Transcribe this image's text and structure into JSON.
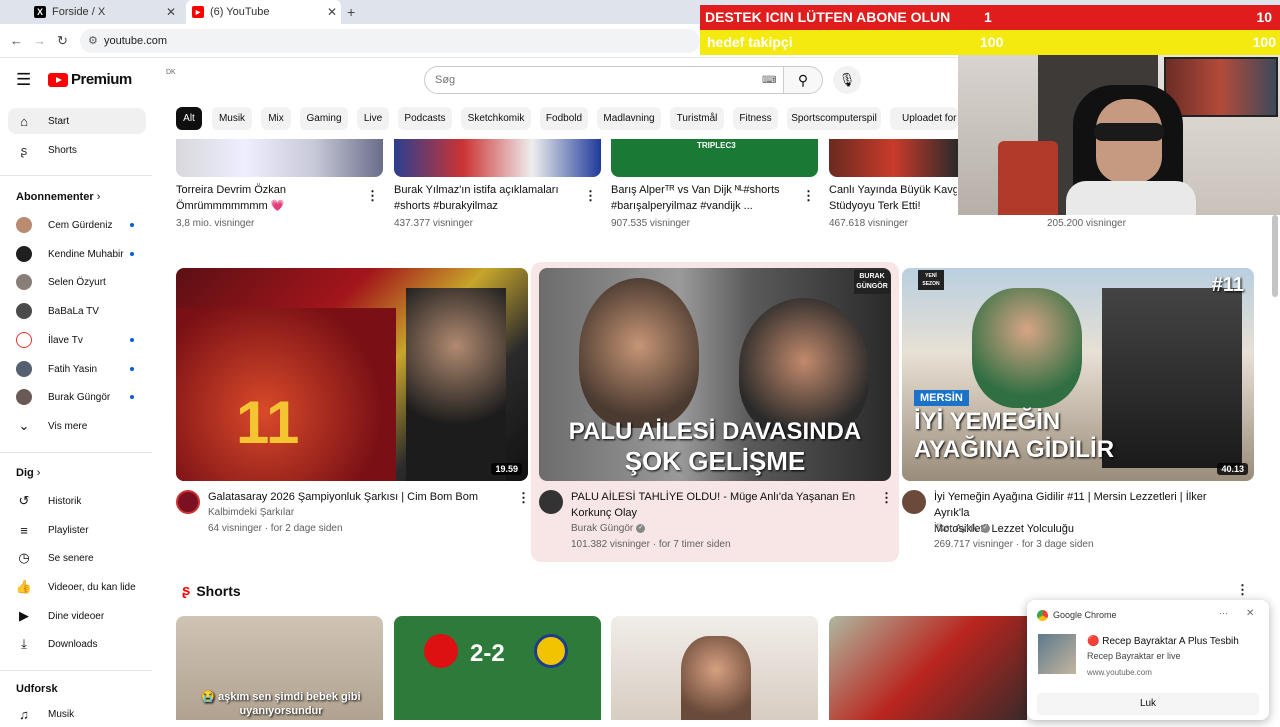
{
  "browser": {
    "tabs": [
      {
        "label": "Forside / X",
        "icon": "x-logo-icon"
      },
      {
        "label": "(6) YouTube",
        "icon": "youtube-icon"
      }
    ],
    "url": "youtube.com"
  },
  "overlay": {
    "line1": {
      "text": "DESTEK ICIN LÜTFEN ABONE OLUN",
      "current": "1",
      "target": "10"
    },
    "line2": {
      "text": "hedef takipçi",
      "current": "100",
      "target": "100"
    }
  },
  "header": {
    "logo": "Premium",
    "region": "DK",
    "search_placeholder": "Søg"
  },
  "sidebar": {
    "main": [
      {
        "label": "Start",
        "icon": "home-icon"
      },
      {
        "label": "Shorts",
        "icon": "shorts-icon"
      }
    ],
    "subscriptions_title": "Abonnementer",
    "subscriptions": [
      {
        "label": "Cem Gürdeniz",
        "new": true
      },
      {
        "label": "Kendine Muhabir",
        "new": true
      },
      {
        "label": "Selen Özyurt",
        "new": false
      },
      {
        "label": "BaBaLa TV",
        "new": false
      },
      {
        "label": "İlave Tv",
        "new": true
      },
      {
        "label": "Fatih Yasin",
        "new": true
      },
      {
        "label": "Burak Güngör",
        "new": true
      }
    ],
    "show_more": "Vis mere",
    "you_title": "Dig",
    "you_items": [
      {
        "label": "Historik",
        "icon": "history-icon"
      },
      {
        "label": "Playlister",
        "icon": "playlist-icon"
      },
      {
        "label": "Se senere",
        "icon": "watch-later-icon"
      },
      {
        "label": "Videoer, du kan lide",
        "icon": "like-icon"
      },
      {
        "label": "Dine videoer",
        "icon": "your-videos-icon"
      },
      {
        "label": "Downloads",
        "icon": "download-icon"
      }
    ],
    "explore_title": "Udforsk",
    "explore_items": [
      {
        "label": "Musik",
        "icon": "music-icon"
      }
    ]
  },
  "chips": [
    "Alt",
    "Musik",
    "Mix",
    "Gaming",
    "Live",
    "Podcasts",
    "Sketchkomik",
    "Fodbold",
    "Madlavning",
    "Turistmål",
    "Fitness",
    "Sportscomputerspil",
    "Uploadet for nylig"
  ],
  "row1": [
    {
      "title_line1": "Torreira Devrim Özkan",
      "title_line2": "Ömrümmmmmmm 💗",
      "views": "3,8 mio. visninger",
      "thumb_text": ""
    },
    {
      "title_line1": "Burak Yılmaz'ın istifa açıklamaları",
      "title_line2": "#shorts #burakyilmaz",
      "views": "437.377 visninger",
      "thumb_text": ""
    },
    {
      "title_line1": "Barış Alperᵀᴿ vs Van Dijk ᴺᴸ#shorts",
      "title_line2": "#barışalperyilmaz #vandijk ...",
      "views": "907.535 visninger",
      "thumb_text": "TRIPLEC3"
    },
    {
      "title_line1": "Canlı Yayında Büyük Kavga",
      "title_line2": "Stüdyoyu Terk Etti!",
      "views": "467.618 visninger",
      "thumb_text": ""
    },
    {
      "title_line1": "",
      "title_line2": "",
      "views": "205.200 visninger",
      "thumb_text": ""
    }
  ],
  "row2": [
    {
      "title_line1": "Galatasaray 2026 Şampiyonluk Şarkısı | Cim Bom Bom",
      "title_line2": "",
      "channel": "Kalbimdeki Şarkılar",
      "verified": false,
      "meta": "64 visninger · for 2 dage siden",
      "duration": "19.59"
    },
    {
      "title_line1": "PALU AİLESİ TAHLİYE OLDU! - Müge Anlı'da Yaşanan En",
      "title_line2": "Korkunç Olay",
      "channel": "Burak Güngör",
      "verified": true,
      "meta": "101.382 visninger · for 7 timer siden",
      "duration": "",
      "overlay_line1": "PALU AİLESİ DAVASINDA",
      "overlay_line2": "ŞOK GELİŞME",
      "badge_line1": "BURAK",
      "badge_line2": "GÜNGÖR"
    },
    {
      "title_line1": "İyi Yemeğin Ayağına Gidilir #11 | Mersin Lezzetleri | İlker Ayrık'la",
      "title_line2": "Motosikletli Lezzet Yolculuğu",
      "channel": "İlker Ayrık",
      "verified": true,
      "meta": "269.717 visninger · for 3 dage siden",
      "duration": "40.13",
      "overlay_tag": "MERSİN",
      "overlay_line1": "İYİ YEMEĞİN",
      "overlay_line2": "AYAĞINA GİDİLİR",
      "episode": "#11",
      "badge_line1": "YENİ",
      "badge_line2": "SEZON"
    }
  ],
  "shorts": {
    "title": "Shorts",
    "items": [
      {
        "caption": "😭 aşkım sen şimdi bebek gibi uyanıyorsundur"
      },
      {
        "caption": "2-2"
      },
      {
        "caption": ""
      },
      {
        "caption": ""
      }
    ]
  },
  "notification": {
    "app": "Google Chrome",
    "title": "🔴 Recep Bayraktar A Plus Tesbih",
    "body": "Recep Bayraktar er live",
    "source": "www.youtube.com",
    "button": "Luk"
  },
  "colors": {
    "youtube_red": "#ff0000",
    "overlay_red": "#e01c1c",
    "overlay_yellow": "#f5ea10",
    "link_blue": "#065fd4"
  }
}
